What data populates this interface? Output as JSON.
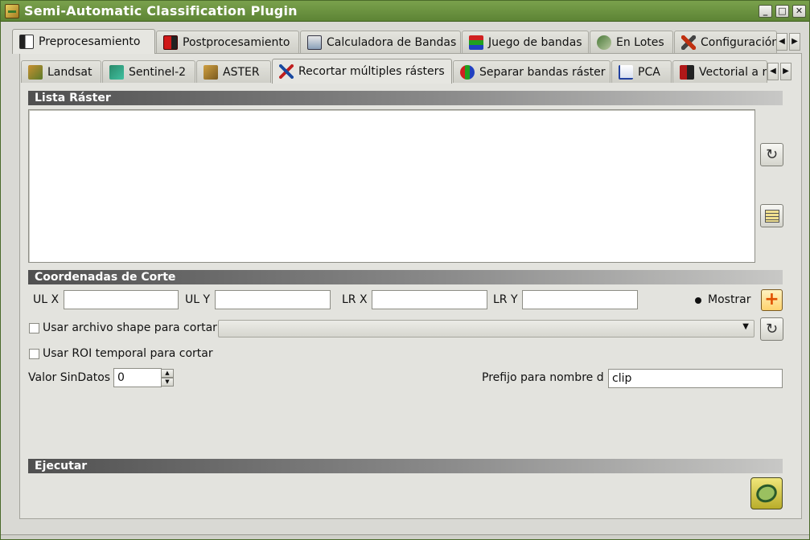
{
  "window": {
    "title": "Semi-Automatic Classification Plugin",
    "minimize": "_",
    "maximize": "□",
    "close": "✕"
  },
  "top_tabs": [
    {
      "label": "Preprocesamiento",
      "icon": "preprocessing-icon",
      "active": true
    },
    {
      "label": "Postprocesamiento",
      "icon": "postprocessing-icon",
      "active": false
    },
    {
      "label": "Calculadora de Bandas",
      "icon": "band-calc-icon",
      "active": false
    },
    {
      "label": "Juego de bandas",
      "icon": "band-set-icon",
      "active": false
    },
    {
      "label": "En Lotes",
      "icon": "batch-icon",
      "active": false
    },
    {
      "label": "Configuración",
      "icon": "settings-icon",
      "active": false
    }
  ],
  "sub_tabs": [
    {
      "label": "Landsat",
      "icon": "landsat-icon",
      "active": false
    },
    {
      "label": "Sentinel-2",
      "icon": "sentinel-icon",
      "active": false
    },
    {
      "label": "ASTER",
      "icon": "aster-icon",
      "active": false
    },
    {
      "label": "Recortar múltiples rásters",
      "icon": "clip-icon",
      "active": true
    },
    {
      "label": "Separar bandas ráster",
      "icon": "split-icon",
      "active": false
    },
    {
      "label": "PCA",
      "icon": "pca-icon",
      "active": false
    },
    {
      "label": "Vectorial a r",
      "icon": "vector-icon",
      "active": false
    }
  ],
  "scroll": {
    "left": "◀",
    "right": "▶"
  },
  "sections": {
    "raster_list": "Lista Ráster",
    "clip_coords": "Coordenadas de Corte",
    "run": "Ejecutar"
  },
  "coords": {
    "ulx_label": "UL X",
    "uly_label": "UL Y",
    "lrx_label": "LR X",
    "lry_label": "LR Y",
    "ulx_value": "",
    "uly_value": "",
    "lrx_value": "",
    "lry_value": "",
    "show_label": "Mostrar"
  },
  "options": {
    "use_shapefile_label": "Usar archivo shape para cortar",
    "use_roi_label": "Usar ROI temporal para cortar",
    "nodata_label": "Valor SinDatos",
    "nodata_value": "0",
    "prefix_label": "Prefijo para nombre de s",
    "prefix_value": "clip"
  },
  "colors": {
    "titlebar": "#5d8435",
    "section_header": "#505050",
    "panel_bg": "#e3e3de"
  }
}
